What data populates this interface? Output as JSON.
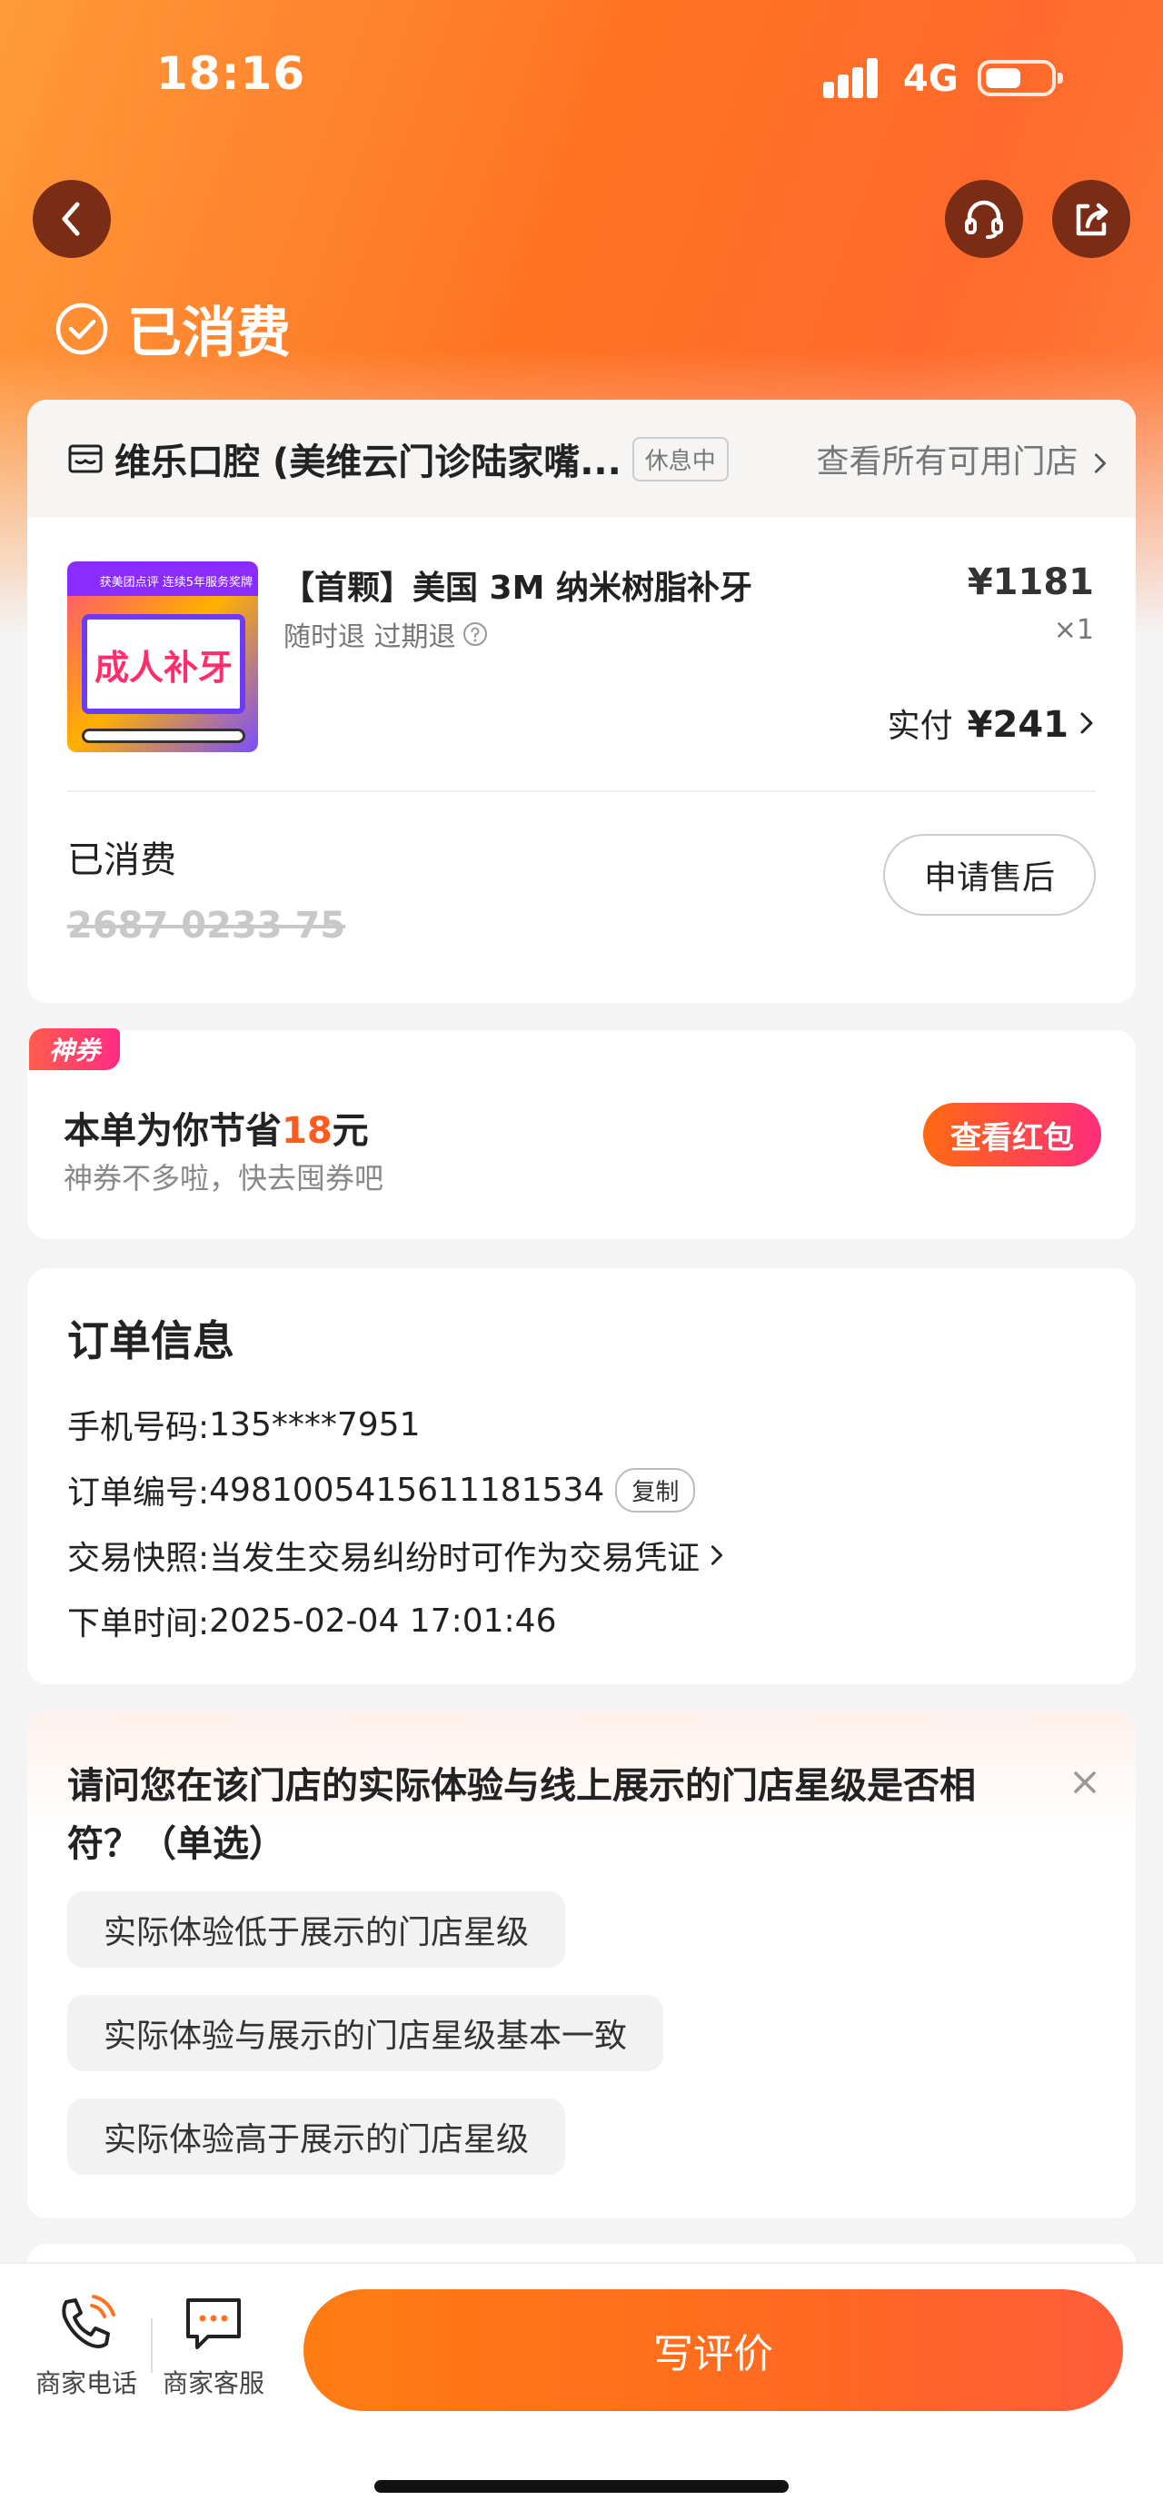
{
  "status_bar": {
    "time": "18:16",
    "network": "4G"
  },
  "header": {
    "order_status": "已消费"
  },
  "store": {
    "name": "维乐口腔 (美维云门诊陆家嘴...",
    "badge": "休息中",
    "all_stores_link": "查看所有可用门店"
  },
  "product": {
    "title": "【首颗】美国 3M 纳米树脂补牙",
    "tags": "随时退 过期退",
    "price": "¥1181",
    "quantity": "×1",
    "thumb_banner": "获美团点评 连续5年服务奖牌",
    "thumb_text": "成人补牙",
    "paid_label": "实付",
    "paid_amount": "¥241"
  },
  "voucher": {
    "status": "已消费",
    "code": "2687 0233 75",
    "after_sale_label": "申请售后"
  },
  "coupon": {
    "tag": "神券",
    "save_prefix": "本单为你节省",
    "save_amount": "18",
    "save_suffix": "元",
    "subtitle": "神券不多啦，快去囤券吧",
    "button": "查看红包"
  },
  "order_info": {
    "title": "订单信息",
    "phone_label": "手机号码:",
    "phone": "135****7951",
    "order_no_label": "订单编号:",
    "order_no": "4981005415611181534",
    "copy_label": "复制",
    "snapshot_label": "交易快照:",
    "snapshot_text": "当发生交易纠纷时可作为交易凭证",
    "time_label": "下单时间:",
    "time": "2025-02-04 17:01:46"
  },
  "survey": {
    "question": "请问您在该门店的实际体验与线上展示的门店星级是否相符？（单选）",
    "options": [
      "实际体验低于展示的门店星级",
      "实际体验与展示的门店星级基本一致",
      "实际体验高于展示的门店星级"
    ]
  },
  "bottom_bar": {
    "phone_label": "商家电话",
    "chat_label": "商家客服",
    "review_button": "写评价"
  },
  "colors": {
    "brand_orange": "#ff7424",
    "price_highlight": "#ff5a1f",
    "dark_button": "#7a2d14"
  }
}
